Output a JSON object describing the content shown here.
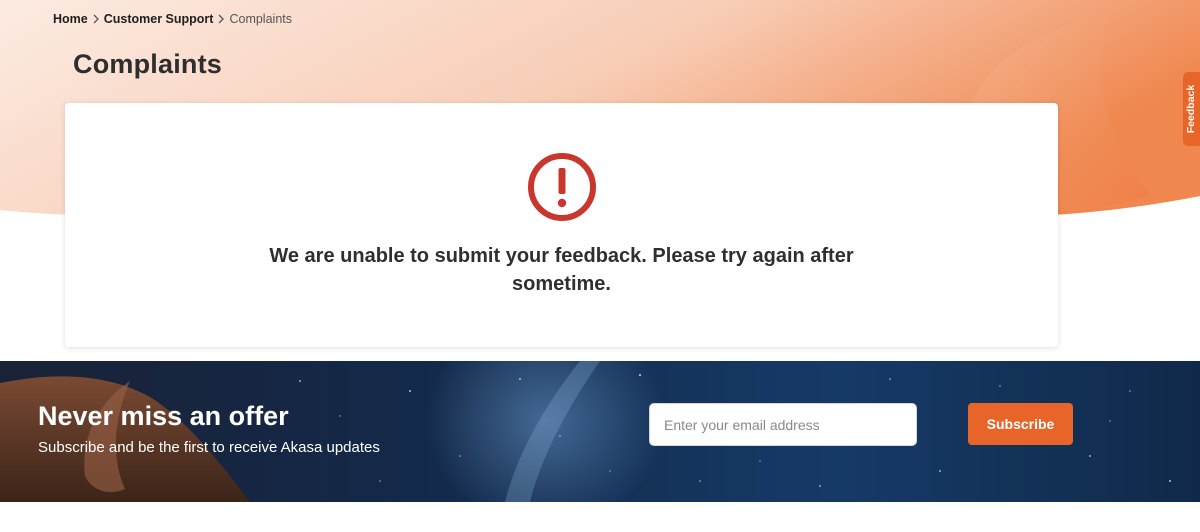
{
  "breadcrumb": {
    "items": [
      "Home",
      "Customer Support",
      "Complaints"
    ]
  },
  "page": {
    "title": "Complaints"
  },
  "feedback_tab": {
    "label": "Feedback"
  },
  "card": {
    "icon": "error-exclamation-icon",
    "message": "We are unable to submit your feedback. Please try again after sometime."
  },
  "newsletter": {
    "heading": "Never miss an offer",
    "subheading": "Subscribe and be the first to receive Akasa updates",
    "email_placeholder": "Enter your email address",
    "email_value": "",
    "subscribe_label": "Subscribe"
  },
  "colors": {
    "accent": "#e8652a",
    "error": "#c8362c",
    "hero_light": "#fbe4d8",
    "hero_dark": "#ef8a55",
    "newsletter_bg": "#0f2440"
  }
}
